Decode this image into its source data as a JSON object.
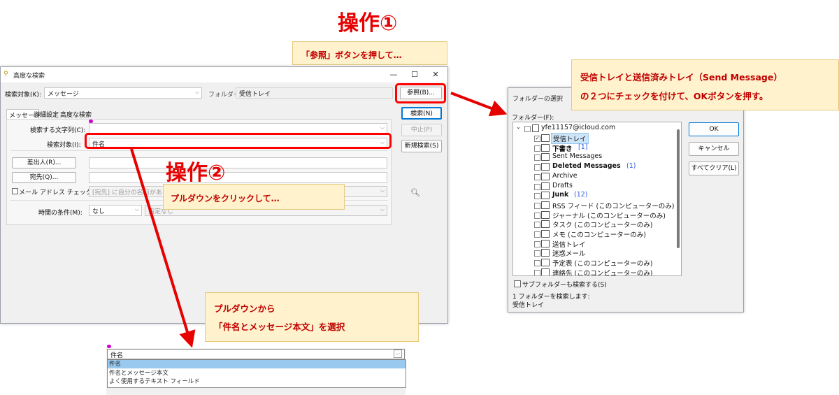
{
  "annotations": {
    "op1_title": "操作①",
    "op1_callout": "「参照」ボタンを押して…",
    "op2_title": "操作②",
    "op2_callout": "プルダウンをクリックして…",
    "right_callout_line1": "受信トレイと送信済みトレイ（Send Message）",
    "right_callout_line2": "の２つにチェックを付けて、OKボタンを押す。",
    "bottom_callout_line1": "プルダウンから",
    "bottom_callout_line2": "「件名とメッセージ本文」を選択",
    "accent_color": "#ff0000",
    "callout_bg": "#fff2cc"
  },
  "search_window": {
    "title": "高度な検索",
    "minimize_icon": "minimize-icon",
    "maximize_icon": "maximize-icon",
    "close_icon": "close-icon",
    "search_target_label": "検索対象(K):",
    "search_target_value": "メッセージ",
    "folder_label": "フォルダー:",
    "folder_value": "受信トレイ",
    "browse_button": "参照(B)...",
    "search_button": "検索(N)",
    "stop_button": "中止(P)",
    "new_search_button": "新規検索(S)",
    "tabs": [
      "メッセージ",
      "詳細設定",
      "高度な検索"
    ],
    "keyword_label": "検索する文字列(C):",
    "keyword_value": "",
    "field_label": "検索対象(I):",
    "field_value": "件名",
    "from_button": "差出人(R)...",
    "to_button": "宛先(Q)...",
    "email_check_label": "メール アドレス チェック(W):",
    "email_check_value": "[宛先] に自分の名前がある",
    "time_label": "時間の条件(M):",
    "time_value": "なし",
    "time_value2": "指定なし"
  },
  "folder_dialog": {
    "title": "フォルダーの選択",
    "folder_label": "フォルダー(F):",
    "account": "yfe11157@icloud.com",
    "items": [
      {
        "label": "受信トレイ",
        "count": "",
        "bold": false,
        "checked": true,
        "selected": true,
        "icon": "inbox-icon"
      },
      {
        "label": "下書き",
        "count": "[1]",
        "bold": true,
        "checked": false,
        "selected": false,
        "icon": "drafts-icon"
      },
      {
        "label": "Sent Messages",
        "count": "",
        "bold": false,
        "checked": false,
        "selected": false,
        "icon": "folder-icon"
      },
      {
        "label": "Deleted Messages",
        "count": "(1)",
        "bold": true,
        "checked": false,
        "selected": false,
        "icon": "folder-icon"
      },
      {
        "label": "Archive",
        "count": "",
        "bold": false,
        "checked": false,
        "selected": false,
        "icon": "folder-icon"
      },
      {
        "label": "Drafts",
        "count": "",
        "bold": false,
        "checked": false,
        "selected": false,
        "icon": "folder-icon"
      },
      {
        "label": "Junk",
        "count": "(12)",
        "bold": true,
        "checked": false,
        "selected": false,
        "icon": "folder-icon"
      },
      {
        "label": "RSS フィード (このコンピューターのみ)",
        "count": "",
        "bold": false,
        "checked": false,
        "selected": false,
        "icon": "rss-icon"
      },
      {
        "label": "ジャーナル (このコンピューターのみ)",
        "count": "",
        "bold": false,
        "checked": false,
        "selected": false,
        "icon": "journal-icon"
      },
      {
        "label": "タスク (このコンピューターのみ)",
        "count": "",
        "bold": false,
        "checked": false,
        "selected": false,
        "icon": "task-icon"
      },
      {
        "label": "メモ (このコンピューターのみ)",
        "count": "",
        "bold": false,
        "checked": false,
        "selected": false,
        "icon": "note-icon"
      },
      {
        "label": "送信トレイ",
        "count": "",
        "bold": false,
        "checked": false,
        "selected": false,
        "icon": "outbox-icon"
      },
      {
        "label": "迷惑メール",
        "count": "",
        "bold": false,
        "checked": false,
        "selected": false,
        "icon": "junk-icon"
      },
      {
        "label": "予定表 (このコンピューターのみ)",
        "count": "",
        "bold": false,
        "checked": false,
        "selected": false,
        "icon": "calendar-icon"
      },
      {
        "label": "連絡先 (このコンピューターのみ)",
        "count": "",
        "bold": false,
        "checked": false,
        "selected": false,
        "icon": "contacts-icon"
      }
    ],
    "ok_button": "OK",
    "cancel_button": "キャンセル",
    "clear_button": "すべてクリア(L)",
    "subfolder_label": "サブフォルダーも検索する(S)",
    "status_line1": "1 フォルダーを検索します:",
    "status_line2": "受信トレイ"
  },
  "dropdown": {
    "value": "件名",
    "options": [
      "件名",
      "件名とメッセージ本文",
      "よく使用するテキスト フィールド"
    ],
    "selected_index": 0
  }
}
